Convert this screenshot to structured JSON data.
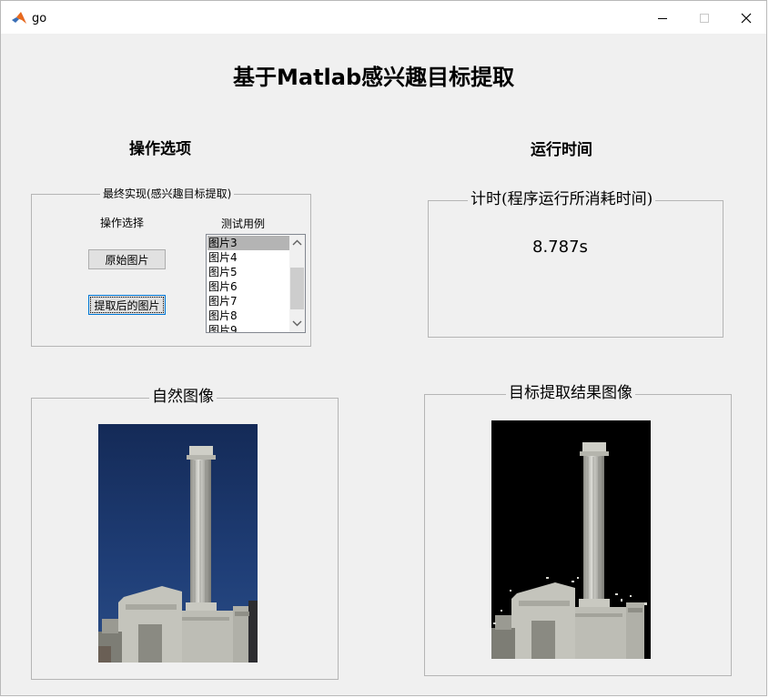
{
  "window": {
    "title": "go",
    "icon": "matlab-icon",
    "controls": [
      "minimize-icon",
      "maximize-icon",
      "close-icon"
    ]
  },
  "header": {
    "title": "基于Matlab感兴趣目标提取"
  },
  "sections": {
    "options_title": "操作选项",
    "runtime_title": "运行时间"
  },
  "operations_panel": {
    "title": "最终实现(感兴趣目标提取)",
    "select_label": "操作选择",
    "test_label": "测试用例",
    "original_button": "原始图片",
    "extracted_button": "提取后的图片",
    "list": {
      "items": [
        "图片3",
        "图片4",
        "图片5",
        "图片6",
        "图片7",
        "图片8",
        "图片9"
      ],
      "selected": "图片3"
    }
  },
  "timer_panel": {
    "title": "计时(程序运行所消耗时间)",
    "value": "8.787s"
  },
  "natural_panel": {
    "title": "自然图像"
  },
  "result_panel": {
    "title": "目标提取结果图像"
  },
  "colors": {
    "window_bg": "#f0f0f0",
    "sky_blue": "#1e3a6e",
    "result_bg": "#000000",
    "list_selection": "#b4b4b4"
  }
}
